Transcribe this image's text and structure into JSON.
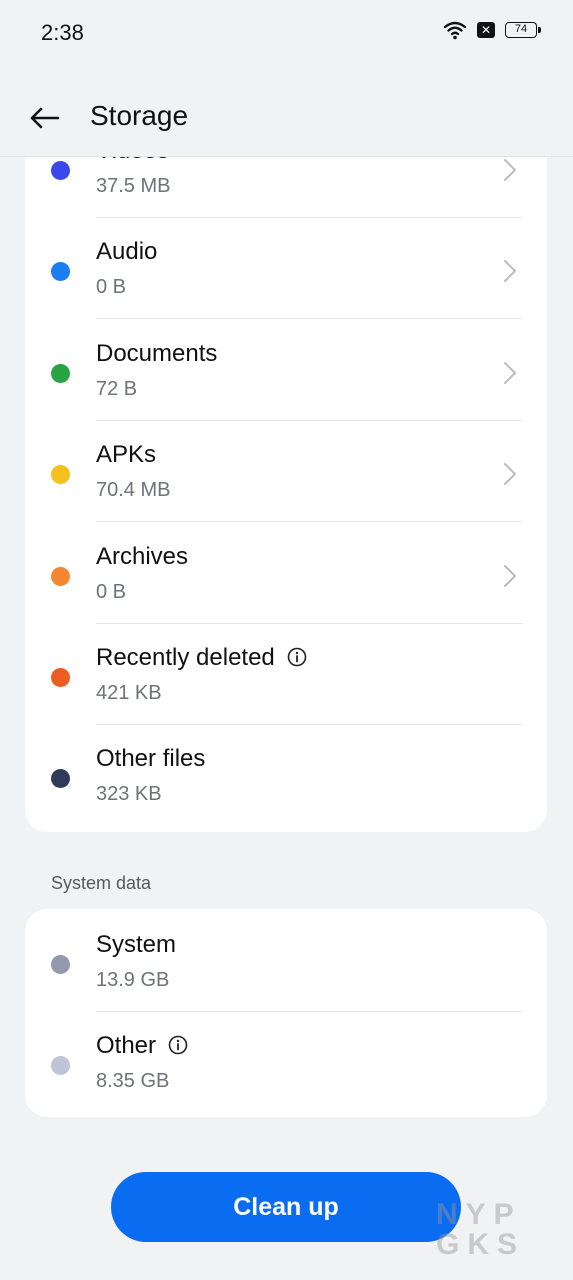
{
  "status_bar": {
    "time": "2:38",
    "battery": "74"
  },
  "header": {
    "title": "Storage"
  },
  "files": [
    {
      "label": "Videos",
      "size": "37.5 MB",
      "color": "#3a47ea",
      "has_chevron": true,
      "has_info": false
    },
    {
      "label": "Audio",
      "size": "0 B",
      "color": "#1a7df2",
      "has_chevron": true,
      "has_info": false
    },
    {
      "label": "Documents",
      "size": "72 B",
      "color": "#27a343",
      "has_chevron": true,
      "has_info": false
    },
    {
      "label": "APKs",
      "size": "70.4 MB",
      "color": "#f6c120",
      "has_chevron": true,
      "has_info": false
    },
    {
      "label": "Archives",
      "size": "0 B",
      "color": "#f4872f",
      "has_chevron": true,
      "has_info": false
    },
    {
      "label": "Recently deleted",
      "size": "421 KB",
      "color": "#ec5d22",
      "has_chevron": false,
      "has_info": true
    },
    {
      "label": "Other files",
      "size": "323 KB",
      "color": "#303a5b",
      "has_chevron": false,
      "has_info": false
    }
  ],
  "system_section": {
    "title": "System data",
    "items": [
      {
        "label": "System",
        "size": "13.9 GB",
        "color": "#9499ae",
        "has_info": false
      },
      {
        "label": "Other",
        "size": "8.35 GB",
        "color": "#c0c4d9",
        "has_info": true
      }
    ]
  },
  "clean_button": {
    "label": "Clean up",
    "color": "#0a6cf0"
  },
  "watermark": {
    "line1": "NYP",
    "line2": "GKS"
  }
}
